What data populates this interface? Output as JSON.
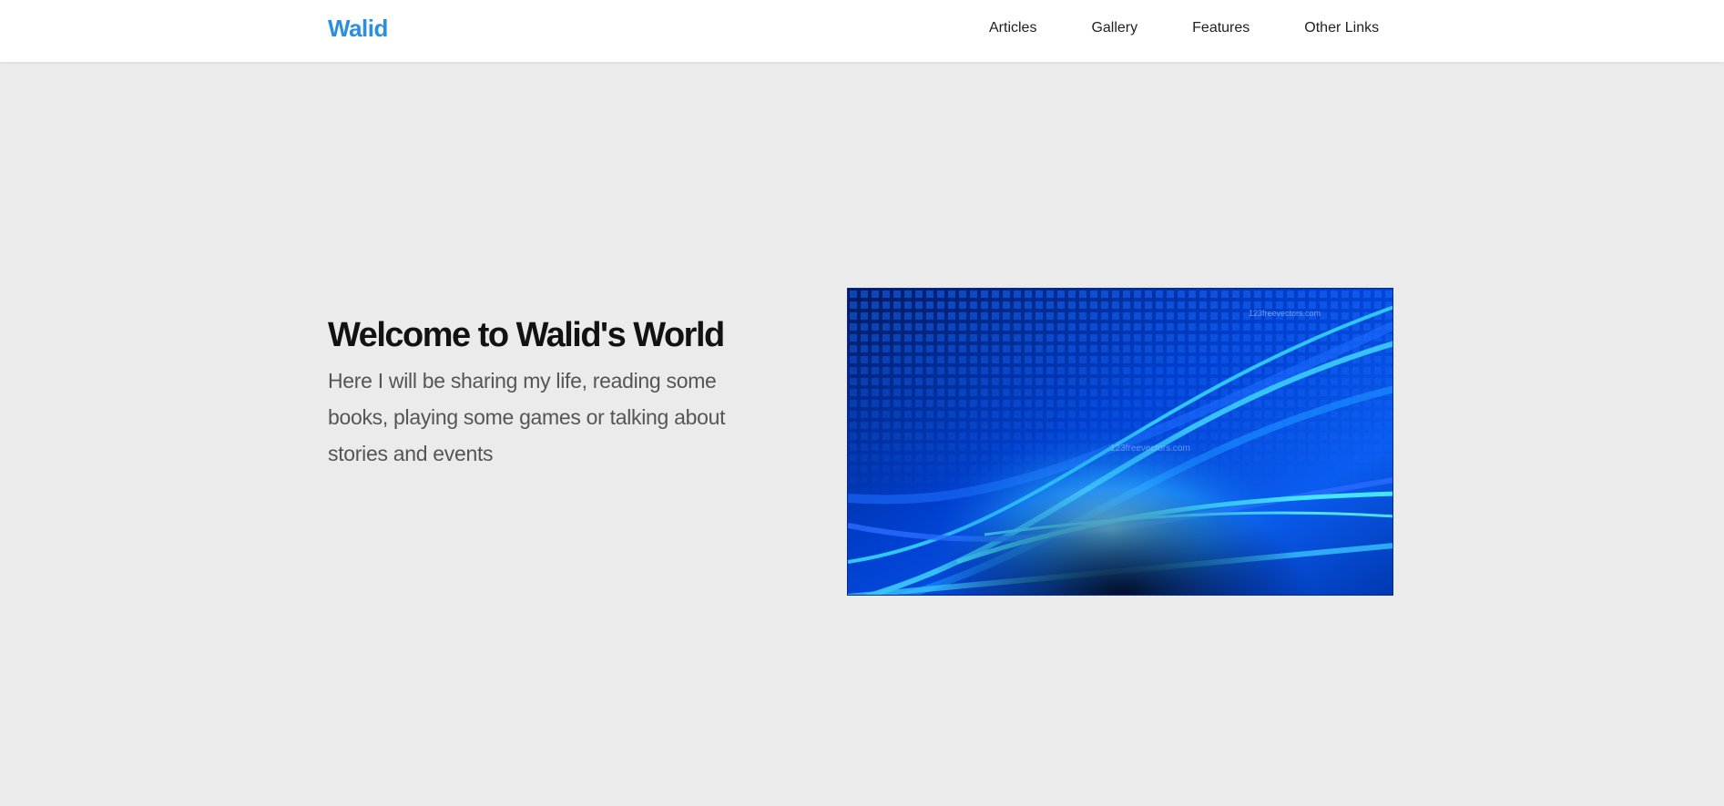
{
  "header": {
    "logo": "Walid",
    "nav": [
      "Articles",
      "Gallery",
      "Features",
      "Other Links"
    ]
  },
  "hero": {
    "title": "Welcome to Walid's World",
    "subtitle": "Here I will be sharing my life, reading some books, playing some games or talking about stories and events",
    "image": {
      "description": "abstract-blue-wave-background",
      "watermark": "123freevectors.com"
    }
  },
  "colors": {
    "brand": "#2a8fe0",
    "background": "#ebebeb",
    "header_bg": "#ffffff"
  }
}
